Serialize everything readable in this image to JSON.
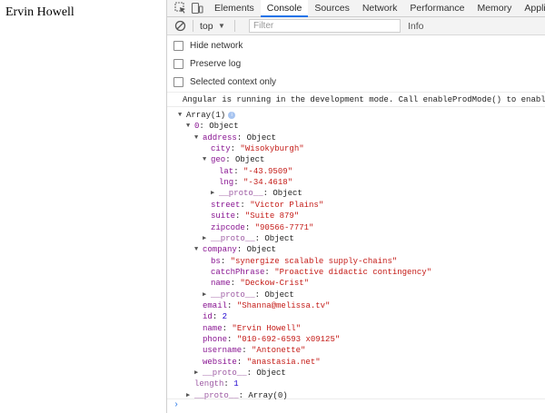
{
  "page": {
    "heading": "Ervin Howell"
  },
  "devtools": {
    "tabs": [
      "Elements",
      "Console",
      "Sources",
      "Network",
      "Performance",
      "Memory",
      "Application"
    ],
    "active_tab": "Console",
    "toolbar": {
      "context": "top",
      "filter_placeholder": "Filter",
      "levels": "Info"
    },
    "settings": [
      "Hide network",
      "Preserve log",
      "Selected context only"
    ],
    "message": "Angular is running in the development mode. Call enableProdMode() to enable th",
    "tree": [
      {
        "d": 0,
        "t": "down",
        "parts": [
          [
            "",
            "Array(1)"
          ]
        ],
        "badge": "i"
      },
      {
        "d": 1,
        "t": "down",
        "parts": [
          [
            "k",
            "0"
          ],
          [
            "",
            ": Object"
          ]
        ]
      },
      {
        "d": 2,
        "t": "down",
        "parts": [
          [
            "k",
            "address"
          ],
          [
            "",
            ": Object"
          ]
        ]
      },
      {
        "d": 3,
        "t": "",
        "parts": [
          [
            "k",
            "city"
          ],
          [
            "",
            ": "
          ],
          [
            "s",
            "\"Wisokyburgh\""
          ]
        ]
      },
      {
        "d": 3,
        "t": "down",
        "parts": [
          [
            "k",
            "geo"
          ],
          [
            "",
            ": Object"
          ]
        ]
      },
      {
        "d": 4,
        "t": "",
        "parts": [
          [
            "k",
            "lat"
          ],
          [
            "",
            ": "
          ],
          [
            "s",
            "\"-43.9509\""
          ]
        ]
      },
      {
        "d": 4,
        "t": "",
        "parts": [
          [
            "k",
            "lng"
          ],
          [
            "",
            ": "
          ],
          [
            "s",
            "\"-34.4618\""
          ]
        ]
      },
      {
        "d": 4,
        "t": "right",
        "parts": [
          [
            "kd",
            "__proto__"
          ],
          [
            "",
            ": Object"
          ]
        ]
      },
      {
        "d": 3,
        "t": "",
        "parts": [
          [
            "k",
            "street"
          ],
          [
            "",
            ": "
          ],
          [
            "s",
            "\"Victor Plains\""
          ]
        ]
      },
      {
        "d": 3,
        "t": "",
        "parts": [
          [
            "k",
            "suite"
          ],
          [
            "",
            ": "
          ],
          [
            "s",
            "\"Suite 879\""
          ]
        ]
      },
      {
        "d": 3,
        "t": "",
        "parts": [
          [
            "k",
            "zipcode"
          ],
          [
            "",
            ": "
          ],
          [
            "s",
            "\"90566-7771\""
          ]
        ]
      },
      {
        "d": 3,
        "t": "right",
        "parts": [
          [
            "kd",
            "__proto__"
          ],
          [
            "",
            ": Object"
          ]
        ]
      },
      {
        "d": 2,
        "t": "down",
        "parts": [
          [
            "k",
            "company"
          ],
          [
            "",
            ": Object"
          ]
        ]
      },
      {
        "d": 3,
        "t": "",
        "parts": [
          [
            "k",
            "bs"
          ],
          [
            "",
            ": "
          ],
          [
            "s",
            "\"synergize scalable supply-chains\""
          ]
        ]
      },
      {
        "d": 3,
        "t": "",
        "parts": [
          [
            "k",
            "catchPhrase"
          ],
          [
            "",
            ": "
          ],
          [
            "s",
            "\"Proactive didactic contingency\""
          ]
        ]
      },
      {
        "d": 3,
        "t": "",
        "parts": [
          [
            "k",
            "name"
          ],
          [
            "",
            ": "
          ],
          [
            "s",
            "\"Deckow-Crist\""
          ]
        ]
      },
      {
        "d": 3,
        "t": "right",
        "parts": [
          [
            "kd",
            "__proto__"
          ],
          [
            "",
            ": Object"
          ]
        ]
      },
      {
        "d": 2,
        "t": "",
        "parts": [
          [
            "k",
            "email"
          ],
          [
            "",
            ": "
          ],
          [
            "s",
            "\"Shanna@melissa.tv\""
          ]
        ]
      },
      {
        "d": 2,
        "t": "",
        "parts": [
          [
            "k",
            "id"
          ],
          [
            "",
            ": "
          ],
          [
            "n",
            "2"
          ]
        ]
      },
      {
        "d": 2,
        "t": "",
        "parts": [
          [
            "k",
            "name"
          ],
          [
            "",
            ": "
          ],
          [
            "s",
            "\"Ervin Howell\""
          ]
        ]
      },
      {
        "d": 2,
        "t": "",
        "parts": [
          [
            "k",
            "phone"
          ],
          [
            "",
            ": "
          ],
          [
            "s",
            "\"010-692-6593 x09125\""
          ]
        ]
      },
      {
        "d": 2,
        "t": "",
        "parts": [
          [
            "k",
            "username"
          ],
          [
            "",
            ": "
          ],
          [
            "s",
            "\"Antonette\""
          ]
        ]
      },
      {
        "d": 2,
        "t": "",
        "parts": [
          [
            "k",
            "website"
          ],
          [
            "",
            ": "
          ],
          [
            "s",
            "\"anastasia.net\""
          ]
        ]
      },
      {
        "d": 2,
        "t": "right",
        "parts": [
          [
            "kd",
            "__proto__"
          ],
          [
            "",
            ": Object"
          ]
        ]
      },
      {
        "d": 1,
        "t": "",
        "parts": [
          [
            "kd",
            "length"
          ],
          [
            "",
            ": "
          ],
          [
            "n",
            "1"
          ]
        ]
      },
      {
        "d": 1,
        "t": "right",
        "parts": [
          [
            "kd",
            "__proto__"
          ],
          [
            "",
            ": Array(0)"
          ]
        ]
      }
    ],
    "prompt": "›"
  }
}
